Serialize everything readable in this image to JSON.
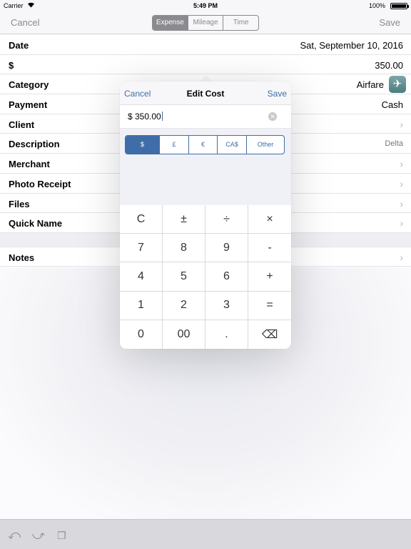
{
  "status_bar": {
    "carrier": "Carrier",
    "time": "5:49 PM",
    "battery": "100%"
  },
  "nav": {
    "cancel": "Cancel",
    "save": "Save",
    "segments": [
      "Expense",
      "Mileage",
      "Time"
    ],
    "active_segment": "Expense"
  },
  "form": {
    "rows": [
      {
        "label": "Date",
        "value": "Sat,  September 10, 2016"
      },
      {
        "label": "$",
        "value": "350.00"
      },
      {
        "label": "Category",
        "value": "Airfare",
        "icon": "airplane-icon"
      },
      {
        "label": "Payment",
        "value": "Cash"
      },
      {
        "label": "Client",
        "value": ""
      },
      {
        "label": "Description",
        "value": "Delta"
      },
      {
        "label": "Merchant",
        "value": ""
      },
      {
        "label": "Photo Receipt",
        "value": ""
      },
      {
        "label": "Files",
        "value": ""
      },
      {
        "label": "Quick Name",
        "value": ""
      }
    ],
    "notes_label": "Notes"
  },
  "popover": {
    "cancel": "Cancel",
    "title": "Edit Cost",
    "save": "Save",
    "input_value": "$ 350.00",
    "currencies": [
      "$",
      "£",
      "€",
      "CA$",
      "Other"
    ],
    "active_currency": "$",
    "keys": [
      "C",
      "±",
      "÷",
      "×",
      "7",
      "8",
      "9",
      "-",
      "4",
      "5",
      "6",
      "+",
      "1",
      "2",
      "3",
      "=",
      "0",
      "00",
      ".",
      "⌫"
    ]
  },
  "toolbar": {
    "icons": [
      "undo-icon",
      "redo-icon",
      "copy-icon"
    ]
  },
  "colors": {
    "accent": "#3f6da8",
    "nav_gray": "#8a8a8f",
    "toolbar_bg": "#d9d9dd"
  }
}
